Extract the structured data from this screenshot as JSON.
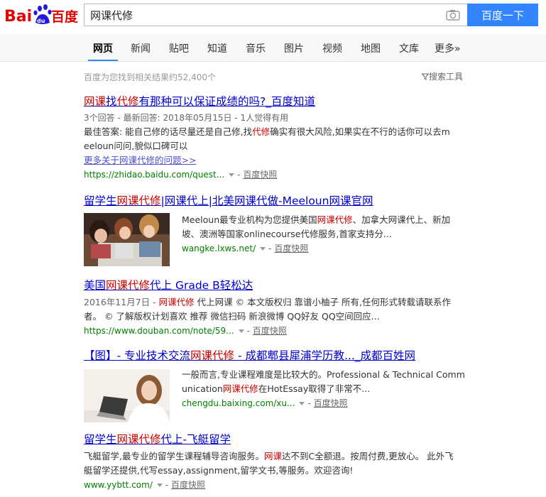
{
  "header": {
    "logo_text": "Bai百度",
    "query": "网课代修",
    "search_button": "百度一下"
  },
  "nav": {
    "tabs": [
      "网页",
      "新闻",
      "贴吧",
      "知道",
      "音乐",
      "图片",
      "视频",
      "地图",
      "文库",
      "更多»"
    ]
  },
  "stats": "百度为您找到相关结果约52,400个",
  "tools": "搜索工具",
  "results": [
    {
      "title_hl1": "网课",
      "title_plain1": "找",
      "title_hl2": "代修",
      "title_plain2": "有那种可以保证成绩的吗?_百度知道",
      "meta": "3个回答 - 最新回答: 2018年05月15日 - 1人觉得有用",
      "abs1_pre": "最佳答案: 能自己修的话尽量还是自己修,找",
      "abs1_hl": "代修",
      "abs1_post": "确实有很大风险,如果实在不行的话你可以去m",
      "abs2": "eeloun问问,貌似口碑可以",
      "more": "更多关于网课代修的问题>>",
      "url": "https://zhidao.baidu.com/quest...",
      "snapshot": "百度快照"
    },
    {
      "title_plain1": "留学生",
      "title_hl": "网课代修",
      "title_plain2": "|网课代上|北美网课代做-Meeloun网课官网",
      "abs1_pre": "Meeloun最专业机构为您提供美国",
      "abs1_hl": "网课代修",
      "abs1_post": "、加拿大网课代上、新加",
      "abs2": "坡、澳洲等国家onlinecourse代修服务,首家支持分...",
      "url": "wangke.lxws.net/",
      "snapshot": "百度快照"
    },
    {
      "title_plain1": "美国",
      "title_hl": "网课代修",
      "title_plain2": "代上 Grade B轻松达",
      "abs1_pre": "2016年11月7日 - ",
      "abs1_hl": "网课代修",
      "abs1_post": " 代上网课 © 本文版权归 靠谱小柚子 所有,任何形式转载请联系作",
      "abs2": "者。 © 了解版权计划喜欢 推荐 微信扫码 新浪微博 QQ好友 QQ空间回应...",
      "url": "https://www.douban.com/note/59...",
      "snapshot": "百度快照"
    },
    {
      "title_plain1": "【图】- 专业技术交流",
      "title_hl": "网课代修",
      "title_plain2": " - 成都郫县犀浦学历教..._成都百姓网",
      "abs1": "一般而言,专业课程难度是比较大的。Professional & Technical Comm",
      "abs2_pre": "unication",
      "abs2_hl": "网课代修",
      "abs2_post": "在HotEssay取得了非常不...",
      "url": "chengdu.baixing.com/xu...",
      "snapshot": "百度快照"
    },
    {
      "title_plain1": "留学生",
      "title_hl": "网课代修",
      "title_plain2": "代上-飞艇留学",
      "abs1_pre": "飞艇留学,最专业的留学生课程辅导咨询服务。",
      "abs1_hl": "网课",
      "abs1_post": "达不到C全额退。按周付费,更放心。 此外飞",
      "abs2": "艇留学还提供,代写essay,assignment,留学文书,等服务。欢迎咨询!",
      "url": "www.yybtt.com/",
      "snapshot": "百度快照"
    }
  ],
  "colors": {
    "brand_red": "#e10602",
    "brand_blue": "#2319dc",
    "button_blue": "#3385ff",
    "link_blue": "#0000cc",
    "highlight_red": "#cc0000",
    "url_green": "#008000"
  }
}
